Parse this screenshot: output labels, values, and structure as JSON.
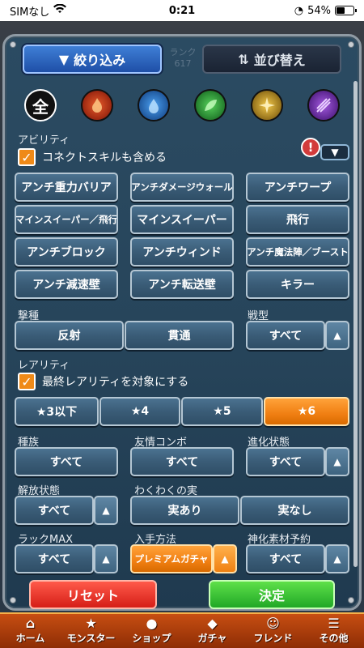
{
  "status": {
    "carrier": "SIMなし",
    "time": "0:21",
    "battery": "54%",
    "battery_level": 0.54
  },
  "tabs": {
    "filter": "絞り込み",
    "sort": "並び替え"
  },
  "background": {
    "rank_label": "ランク",
    "rank_value": "617"
  },
  "attributes": [
    {
      "label": "全",
      "icon": "all-attribute-icon"
    },
    {
      "label": "",
      "icon": "fire-attribute-icon",
      "color": "#c2311e"
    },
    {
      "label": "",
      "icon": "water-attribute-icon",
      "color": "#2b6fc9"
    },
    {
      "label": "",
      "icon": "wood-attribute-icon",
      "color": "#2f9a3a"
    },
    {
      "label": "",
      "icon": "light-attribute-icon",
      "color": "#c79a22"
    },
    {
      "label": "",
      "icon": "dark-attribute-icon",
      "color": "#7a38b8"
    }
  ],
  "ability": {
    "label": "アビリティ",
    "include_connect": "コネクトスキルも含める",
    "buttons": [
      "アンチ重力バリア",
      "アンチダメージウォール",
      "アンチワープ",
      "マインスイーパー／飛行",
      "マインスイーパー",
      "飛行",
      "アンチブロック",
      "アンチウィンド",
      "アンチ魔法陣／ブースト",
      "アンチ減速壁",
      "アンチ転送壁",
      "キラー"
    ]
  },
  "strike_type": {
    "label": "撃種",
    "options": [
      "反射",
      "貫通"
    ]
  },
  "battle_type": {
    "label": "戦型",
    "value": "すべて"
  },
  "rarity": {
    "label": "レアリティ",
    "final_rarity": "最終レアリティを対象にする",
    "options": [
      "★3以下",
      "★4",
      "★5",
      "★6"
    ],
    "selected": "★6"
  },
  "race": {
    "label": "種族",
    "value": "すべて"
  },
  "friend_combo": {
    "label": "友情コンボ",
    "value": "すべて"
  },
  "evolution": {
    "label": "進化状態",
    "value": "すべて"
  },
  "release": {
    "label": "解放状態",
    "value": "すべて"
  },
  "waku": {
    "label": "わくわくの実",
    "options": [
      "実あり",
      "実なし"
    ]
  },
  "luck_max": {
    "label": "ラックMAX",
    "value": "すべて"
  },
  "obtain": {
    "label": "入手方法",
    "value": "プレミアムガチャ"
  },
  "shinka": {
    "label": "神化素材予約",
    "value": "すべて"
  },
  "actions": {
    "reset": "リセット",
    "confirm": "決定"
  },
  "nav": [
    "ホーム",
    "モンスター",
    "ショップ",
    "ガチャ",
    "フレンド",
    "その他"
  ]
}
